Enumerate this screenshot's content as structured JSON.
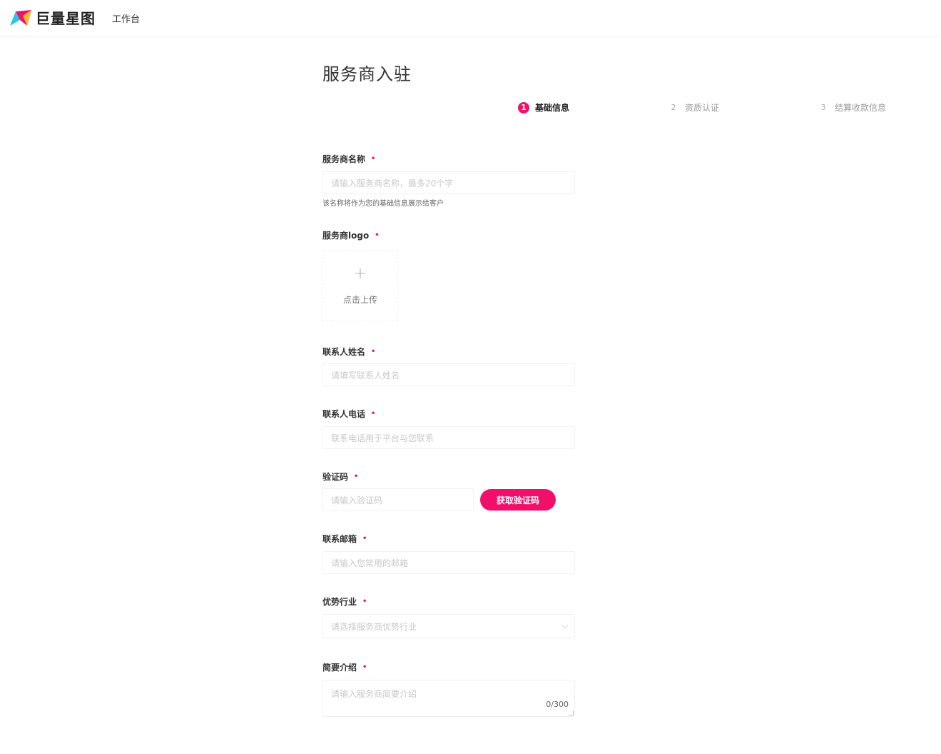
{
  "header": {
    "logo_text": "巨量星图",
    "nav_workbench": "工作台",
    "brand_colors": [
      "#f0106a",
      "#25c8e6",
      "#ffd21e"
    ]
  },
  "page": {
    "title": "服务商入驻"
  },
  "steps": [
    {
      "num": "1",
      "label": "基础信息",
      "active": true
    },
    {
      "num": "2",
      "label": "资质认证",
      "active": false
    },
    {
      "num": "3",
      "label": "结算收款信息",
      "active": false
    }
  ],
  "form": {
    "required_mark": "•",
    "name": {
      "label": "服务商名称",
      "placeholder": "请输入服务商名称，最多20个字",
      "hint": "该名称将作为您的基础信息展示给客户"
    },
    "logo": {
      "label": "服务商logo",
      "plus": "+",
      "upload_text": "点击上传"
    },
    "contact_name": {
      "label": "联系人姓名",
      "placeholder": "请填写联系人姓名"
    },
    "contact_phone": {
      "label": "联系人电话",
      "placeholder": "联系电话用于平台与您联系"
    },
    "verify_code": {
      "label": "验证码",
      "placeholder": "请输入验证码",
      "button": "获取验证码"
    },
    "email": {
      "label": "联系邮箱",
      "placeholder": "请输入您常用的邮箱"
    },
    "industry": {
      "label": "优势行业",
      "placeholder": "请选择服务商优势行业"
    },
    "intro": {
      "label": "简要介绍",
      "placeholder": "请输入服务商简要介绍",
      "counter": "0/300"
    }
  },
  "accent_color": "#f0106a"
}
